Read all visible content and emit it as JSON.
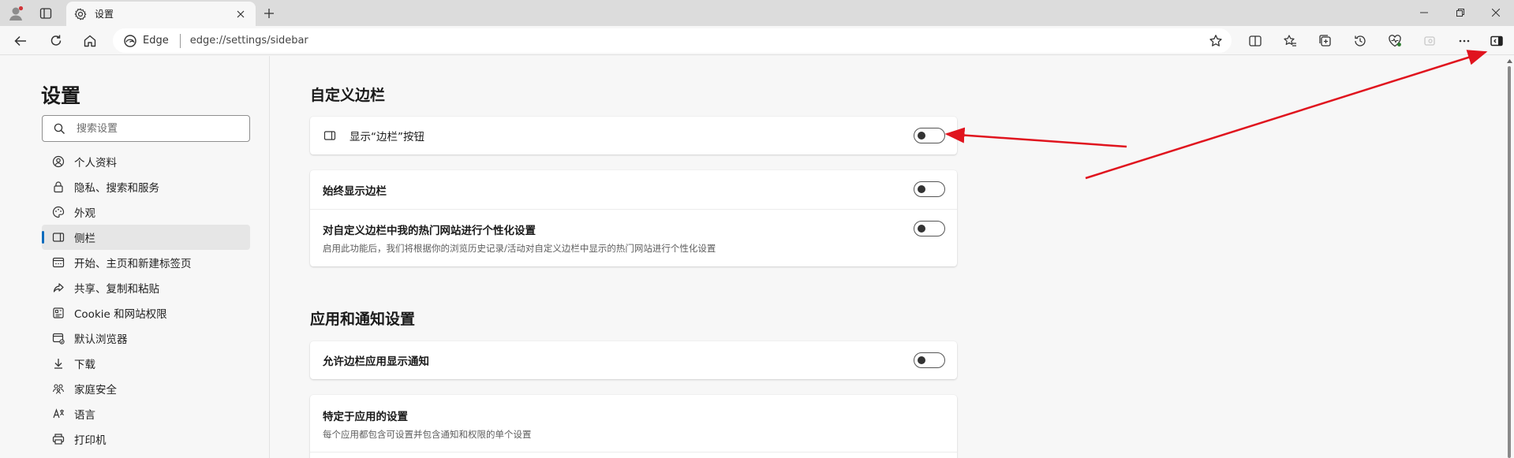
{
  "tab": {
    "title": "设置"
  },
  "toolbar": {
    "address_label": "Edge",
    "url": "edge://settings/sidebar"
  },
  "sidebar": {
    "title": "设置",
    "search_placeholder": "搜索设置",
    "items": [
      {
        "label": "个人资料",
        "icon": "profile-icon",
        "active": false
      },
      {
        "label": "隐私、搜索和服务",
        "icon": "lock-icon",
        "active": false
      },
      {
        "label": "外观",
        "icon": "palette-icon",
        "active": false
      },
      {
        "label": "侧栏",
        "icon": "sidebar-icon",
        "active": true
      },
      {
        "label": "开始、主页和新建标签页",
        "icon": "home-tab-icon",
        "active": false
      },
      {
        "label": "共享、复制和粘贴",
        "icon": "share-icon",
        "active": false
      },
      {
        "label": "Cookie 和网站权限",
        "icon": "permissions-icon",
        "active": false
      },
      {
        "label": "默认浏览器",
        "icon": "default-browser-icon",
        "active": false
      },
      {
        "label": "下载",
        "icon": "download-icon",
        "active": false
      },
      {
        "label": "家庭安全",
        "icon": "family-icon",
        "active": false
      },
      {
        "label": "语言",
        "icon": "language-icon",
        "active": false
      },
      {
        "label": "打印机",
        "icon": "printer-icon",
        "active": false
      }
    ]
  },
  "main": {
    "section1_title": "自定义边栏",
    "show_sidebar_button": {
      "label": "显示“边栏”按钮",
      "on": false
    },
    "always_show_sidebar": {
      "label": "始终显示边栏",
      "on": false
    },
    "personalize_sites": {
      "label": "对自定义边栏中我的热门网站进行个性化设置",
      "description": "启用此功能后，我们将根据你的浏览历史记录/活动对自定义边栏中显示的热门网站进行个性化设置",
      "on": false
    },
    "section2_title": "应用和通知设置",
    "allow_notifications": {
      "label": "允许边栏应用显示通知",
      "on": false
    },
    "app_specific": {
      "label": "特定于应用的设置",
      "description": "每个应用都包含可设置并包含通知和权限的单个设置"
    }
  },
  "colors": {
    "accent": "#0f6cbd",
    "annotation_arrow": "#e0141e"
  }
}
